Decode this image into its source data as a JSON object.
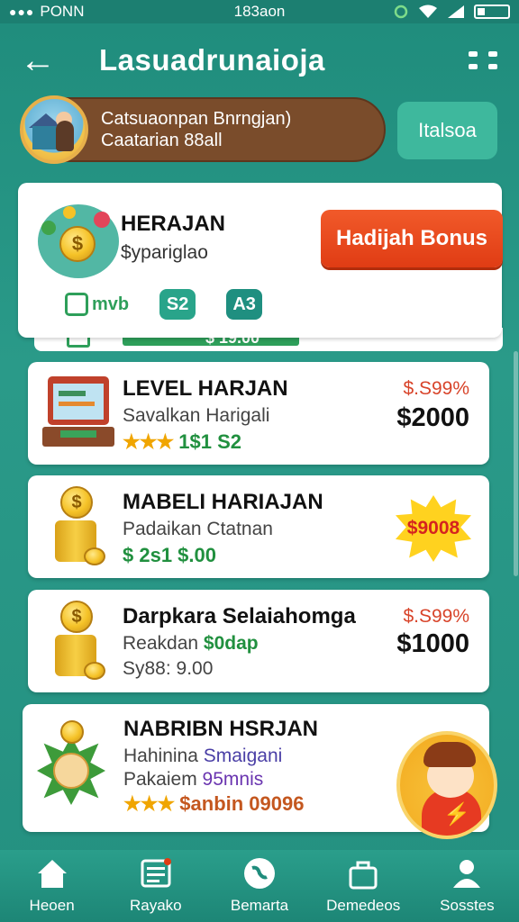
{
  "status_bar": {
    "carrier": "PONN",
    "time": "183aon"
  },
  "header": {
    "title": "Lasuadrunaioja"
  },
  "profile": {
    "line1": "Catsuaonpan Bnrngjan)",
    "line2": "Caatarian 88all",
    "side_button": "Italsoa"
  },
  "featured": {
    "title": "HERAJAN",
    "subtitle": "$ypariglao",
    "bonus_button": "Hadijah Bonus",
    "badges": [
      "mvb",
      "S2",
      "A3"
    ]
  },
  "peek_row": {
    "text": "$ 19.00"
  },
  "items": [
    {
      "title": "LEVEL HARJAN",
      "subtitle": "Savalkan Harigali",
      "stars": "★★★",
      "detail": "1$1 S2",
      "price_small": "$.S99%",
      "price_big": "$2000",
      "icon": "computer-desk-icon"
    },
    {
      "title": "MABELI HARIAJAN",
      "subtitle": "Padaikan Ctatnan",
      "detail": "$ 2s1 $.00",
      "badge": "$9008",
      "icon": "coin-stack-icon"
    },
    {
      "title": "Darpkara Selaiahomga",
      "subtitle": "Reakdan",
      "subtitle_accent": "$0dap",
      "line3": "Sy88: 9.00",
      "price_small": "$.S99%",
      "price_big": "$1000",
      "icon": "coin-stack-icon"
    },
    {
      "title": "NABRIBN HSRJAN",
      "subtitle": "Hahinina",
      "subtitle_accent": "Smaigani",
      "line3_prefix": "Pakaiem",
      "line3_accent": "95mnis",
      "stars": "★★★",
      "detail": "$anbin 09096",
      "icon": "sun-face-icon"
    }
  ],
  "bottom_nav": [
    {
      "label": "Heoen",
      "icon": "home-icon"
    },
    {
      "label": "Rayako",
      "icon": "list-icon"
    },
    {
      "label": "Bemarta",
      "icon": "globe-icon"
    },
    {
      "label": "Demedeos",
      "icon": "bag-icon"
    },
    {
      "label": "Sosstes",
      "icon": "user-icon"
    }
  ],
  "colors": {
    "teal": "#1f8c7c",
    "accent_red": "#e03c14",
    "green": "#21903f",
    "gold": "#f5c227"
  }
}
